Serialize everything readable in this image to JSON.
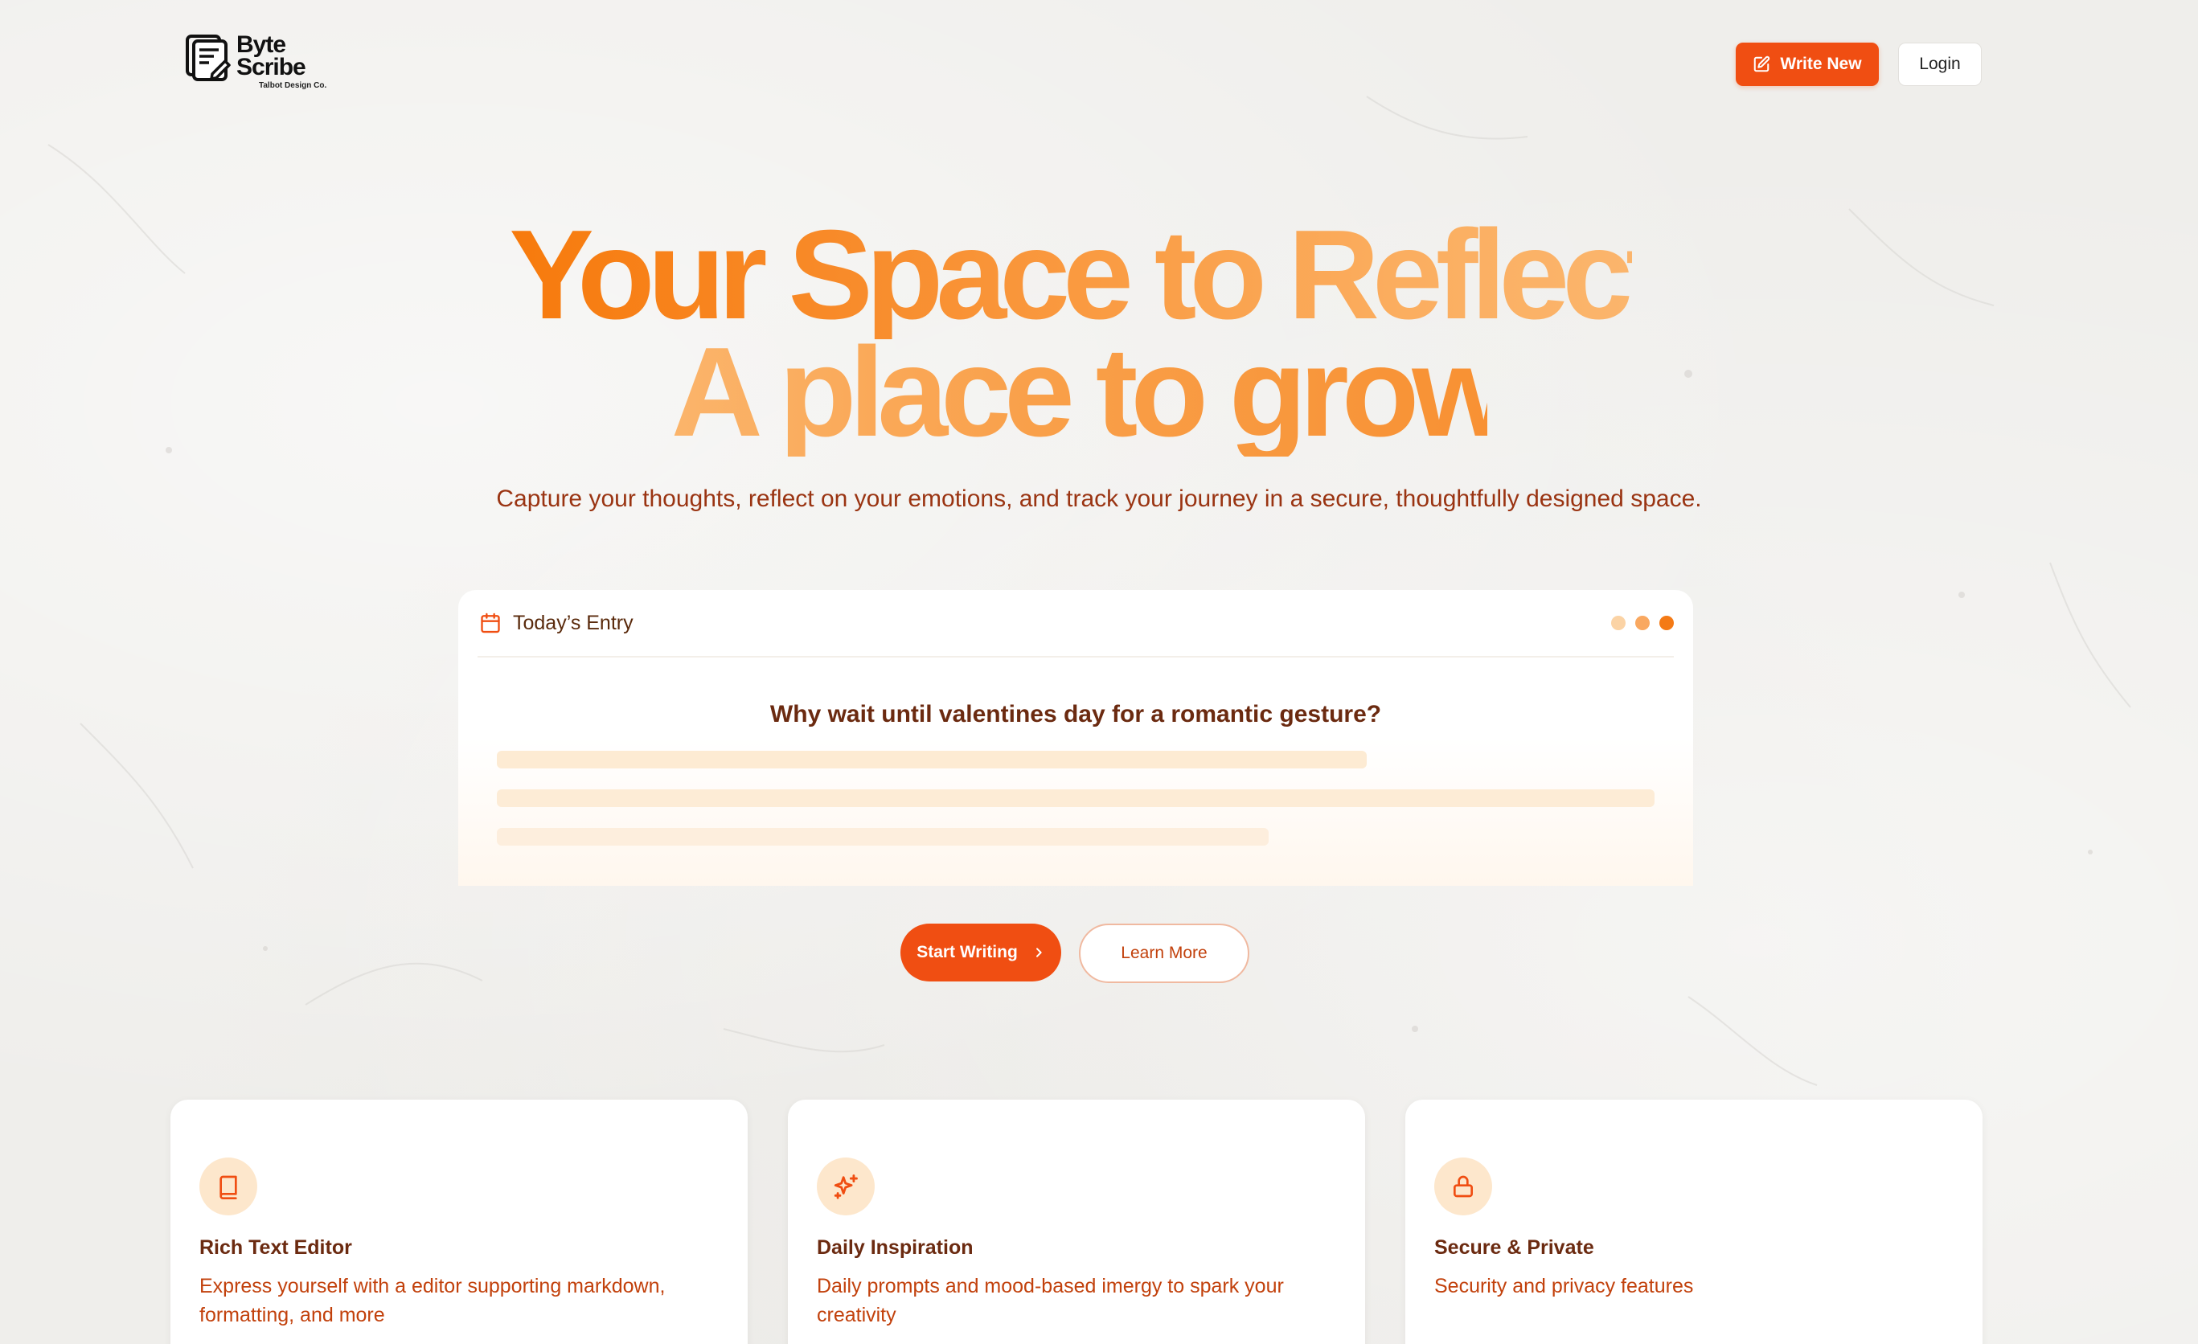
{
  "header": {
    "logo_name_1": "Byte",
    "logo_name_2": "Scribe",
    "logo_sub": "Talbot Design Co.",
    "write_new_label": "Write New",
    "login_label": "Login"
  },
  "hero": {
    "line1": "Your Space to Reflect.",
    "line2": "A place to grow.",
    "subtitle": "Capture your thoughts, reflect on your emotions, and track your journey in a secure, thoughtfully designed space."
  },
  "entry": {
    "title": "Today’s Entry",
    "prompt": "Why wait until valentines day for a romantic gesture?",
    "dot_colors": [
      "#fbd3a5",
      "#f9a860",
      "#f47a15"
    ]
  },
  "cta": {
    "start_label": "Start Writing",
    "learn_label": "Learn More"
  },
  "features": [
    {
      "icon": "book-icon",
      "title": "Rich Text Editor",
      "desc": "Express yourself with a editor supporting markdown, formatting, and more"
    },
    {
      "icon": "sparkles-icon",
      "title": "Daily Inspiration",
      "desc": "Daily prompts and mood-based imergy to spark your creativity"
    },
    {
      "icon": "lock-icon",
      "title": "Secure & Private",
      "desc": "Security and privacy features"
    }
  ],
  "colors": {
    "accent": "#f04e12",
    "text_brown": "#9a3412",
    "icon_bg": "#fde7cc"
  }
}
